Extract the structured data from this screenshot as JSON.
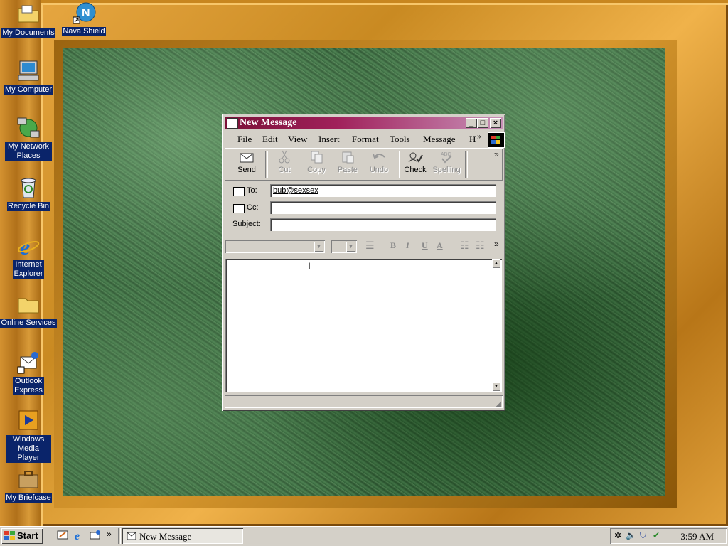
{
  "desktop": {
    "icons": [
      {
        "label": "My Documents"
      },
      {
        "label": "Nava Shield"
      },
      {
        "label": "My Computer"
      },
      {
        "label": "My Network Places"
      },
      {
        "label": "Recycle Bin"
      },
      {
        "label": "Internet Explorer"
      },
      {
        "label": "Online Services"
      },
      {
        "label": "Outlook Express"
      },
      {
        "label": "Windows Media Player"
      },
      {
        "label": "My Briefcase"
      }
    ]
  },
  "window": {
    "title": "New Message",
    "controls": {
      "minimize": "_",
      "maximize": "□",
      "close": "×"
    },
    "menu": [
      "File",
      "Edit",
      "View",
      "Insert",
      "Format",
      "Tools",
      "Message",
      "H"
    ],
    "menu_overflow": "»",
    "toolbar": {
      "buttons": [
        {
          "label": "Send",
          "enabled": true
        },
        {
          "label": "Cut",
          "enabled": false
        },
        {
          "label": "Copy",
          "enabled": false
        },
        {
          "label": "Paste",
          "enabled": false
        },
        {
          "label": "Undo",
          "enabled": false
        },
        {
          "label": "Check",
          "enabled": true
        },
        {
          "label": "Spelling",
          "enabled": false
        }
      ],
      "overflow": "»"
    },
    "header": {
      "to_label": "To:",
      "to_value": "bub@sexsex",
      "cc_label": "Cc:",
      "cc_value": "",
      "subject_label": "Subject:",
      "subject_value": ""
    },
    "format_bar": {
      "font": "",
      "size": "",
      "buttons": [
        "B",
        "I",
        "U",
        "A"
      ],
      "overflow": "»"
    },
    "body_text": ""
  },
  "taskbar": {
    "start_label": "Start",
    "task_button": "New Message",
    "quicklaunch_overflow": "»",
    "clock": "3:59 AM"
  },
  "colors": {
    "titlebar_start": "#7b1238",
    "titlebar_end": "#c890b8",
    "desktop_frame": "#c8861f",
    "chrome": "#d4d0c8",
    "label_bg": "#0a246a"
  }
}
